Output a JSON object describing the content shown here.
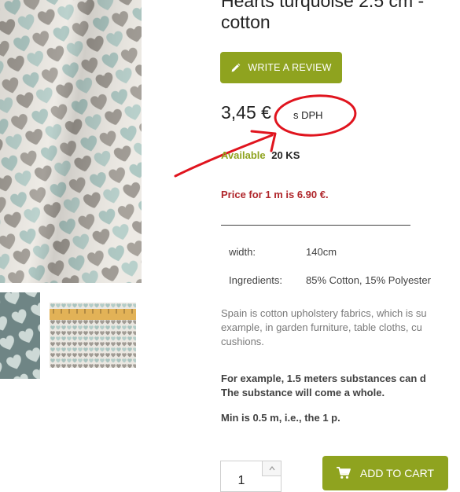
{
  "product": {
    "title_line1": "Hearts turquoise 2.5 cm -",
    "title_line2": "cotton"
  },
  "review_button": {
    "label": "WRITE A REVIEW",
    "icon": "pencil-icon"
  },
  "price": {
    "amount": "3,45 €",
    "tax_label": "s DPH"
  },
  "availability": {
    "label": "Available",
    "quantity": "20 KS"
  },
  "price_note": "Price for 1 m is 6.90 €.",
  "specs": [
    {
      "key": "width:",
      "value": "140cm"
    },
    {
      "key": "Ingredients:",
      "value": "85% Cotton, 15% Polyester"
    }
  ],
  "description": {
    "line1": "Spain is cotton upholstery fabrics, which is su",
    "line2": "example, in garden furniture, table cloths, cu",
    "line3": "cushions."
  },
  "notes": {
    "note1_line1": "For example, 1.5 meters substances can d",
    "note1_line2": "The substance will come a whole.",
    "note2": "Min is 0.5 m, i.e., the 1 p."
  },
  "cart": {
    "quantity": "1",
    "button_label": "ADD TO CART",
    "icon": "cart-icon"
  },
  "colors": {
    "accent": "#8fa31f",
    "price_note": "#b0262b",
    "annotation": "#e0141e",
    "heart_teal": "#a9c4bf",
    "heart_grey": "#a29d96"
  }
}
